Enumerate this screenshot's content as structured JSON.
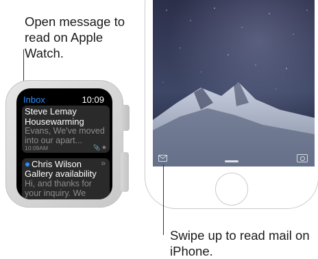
{
  "annotations": {
    "watch_callout": "Open message to read on Apple Watch.",
    "iphone_callout": "Swipe up to read mail on iPhone."
  },
  "watch": {
    "app_title": "Inbox",
    "time": "10:09",
    "messages": [
      {
        "sender": "Steve Lemay",
        "subject": "Housewarming",
        "preview": "Evans, We've moved into our apart...",
        "time": "10:09AM",
        "icons": [
          "paperclip-icon",
          "star-icon"
        ]
      },
      {
        "sender": "Chris Wilson",
        "subject": "Gallery availability",
        "preview": "Hi, and thanks for your inquiry. We",
        "unread": true,
        "icons": [
          "unread-dot",
          "chevron-icon"
        ]
      }
    ],
    "colors": {
      "accent": "#2b8fff",
      "screen": "#000000",
      "card": "#2a2a2a"
    }
  },
  "iphone": {
    "lock_screen_icons": [
      "mail-icon",
      "camera-icon"
    ],
    "wallpaper": "night sky over snowy mountain"
  }
}
